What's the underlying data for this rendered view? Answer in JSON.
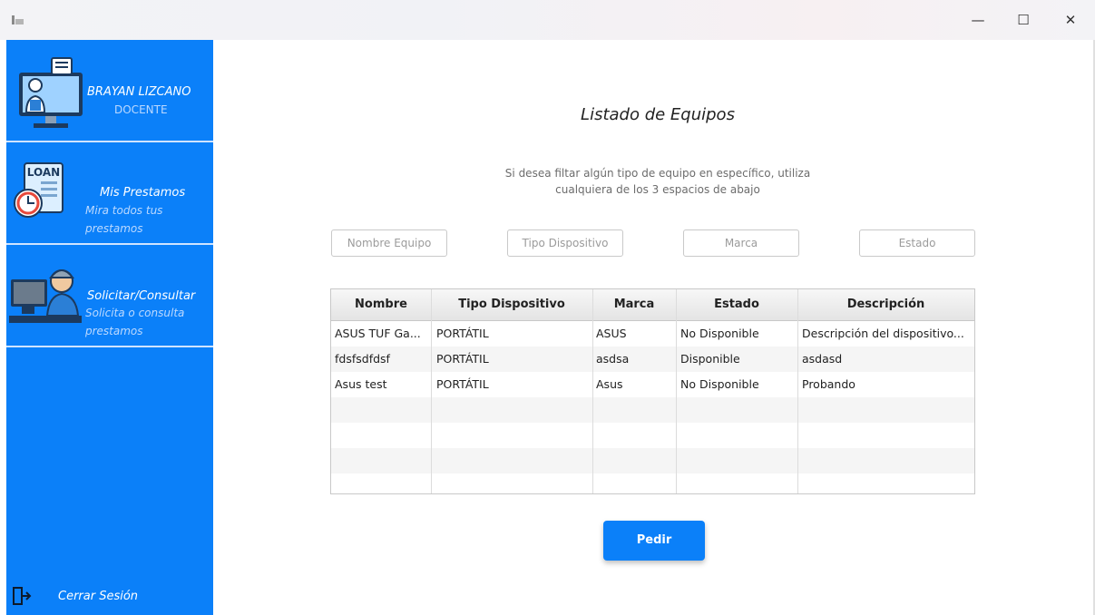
{
  "window": {
    "minimize_glyph": "—",
    "maximize_glyph": "☐",
    "close_glyph": "✕"
  },
  "sidebar": {
    "user": {
      "name": "BRAYAN LIZCANO",
      "role": "DOCENTE",
      "icon": "teacher-computer-icon"
    },
    "items": [
      {
        "title": "Mis Prestamos",
        "subtitle_line1": "Mira todos tus",
        "subtitle_line2": "prestamos",
        "icon": "loan-clock-icon",
        "icon_label": "LOAN"
      },
      {
        "title": "Solicitar/Consultar",
        "subtitle_line1": "Solicita o consulta",
        "subtitle_line2": "prestamos",
        "icon": "person-computer-icon"
      }
    ],
    "logout": {
      "label": "Cerrar Sesión",
      "icon": "logout-door-icon"
    },
    "accent": "#0b80f9"
  },
  "main": {
    "title": "Listado de Equipos",
    "description_line1": "Si desea filtar algún tipo de equipo en específico, utiliza",
    "description_line2": "cualquiera de los 3 espacios de abajo",
    "filters": [
      {
        "placeholder": "Nombre Equipo"
      },
      {
        "placeholder": "Tipo Dispositivo"
      },
      {
        "placeholder": "Marca"
      },
      {
        "placeholder": "Estado"
      }
    ],
    "table": {
      "columns": [
        "Nombre",
        "Tipo Dispositivo",
        "Marca",
        "Estado",
        "Descripción"
      ],
      "rows": [
        [
          "ASUS TUF Ga...",
          "PORTÁTIL",
          "ASUS",
          "No Disponible",
          "Descripción del dispositivo..."
        ],
        [
          "fdsfsdfdsf",
          "PORTÁTIL",
          "asdsa",
          "Disponible",
          "asdasd"
        ],
        [
          "Asus test",
          "PORTÁTIL",
          "Asus",
          "No Disponible",
          "Probando"
        ]
      ]
    },
    "action_button": "Pedir"
  }
}
